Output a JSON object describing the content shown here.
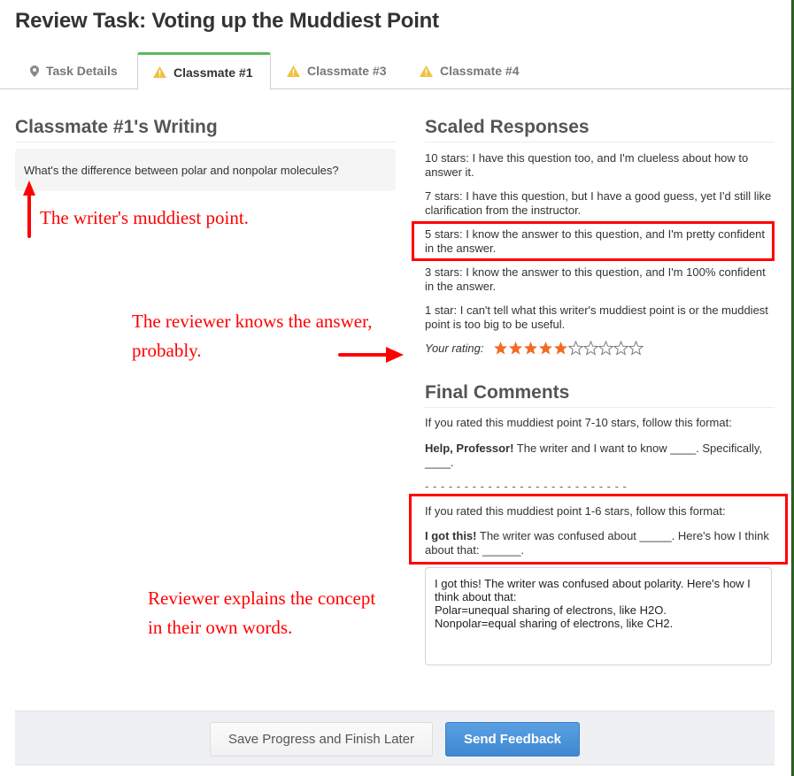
{
  "page": {
    "title": "Review Task: Voting up the Muddiest Point"
  },
  "tabs": [
    {
      "label": "Task Details",
      "icon": "map-pin-icon",
      "active": false
    },
    {
      "label": "Classmate #1",
      "icon": "warning-icon",
      "active": true
    },
    {
      "label": "Classmate #3",
      "icon": "warning-icon",
      "active": false
    },
    {
      "label": "Classmate #4",
      "icon": "warning-icon",
      "active": false
    }
  ],
  "writing": {
    "heading": "Classmate #1's Writing",
    "text": "What's the difference between polar and nonpolar molecules?"
  },
  "scaled": {
    "heading": "Scaled Responses",
    "responses": [
      "10 stars: I have this question too, and I'm clueless about how to answer it.",
      "7 stars: I have this question, but I have a good guess, yet I'd still like clarification from the instructor.",
      "5 stars: I know the answer to this question, and I'm pretty confident in the answer.",
      "3 stars: I know the answer to this question, and I'm 100% confident in the answer.",
      "1 star: I can't tell what this writer's muddiest point is or the muddiest point is too big to be useful."
    ],
    "rating_label": "Your rating:",
    "rating_value": 5,
    "rating_max": 10,
    "star_color": "#f26b22"
  },
  "final": {
    "heading": "Final Comments",
    "high_instruction": "If you rated this muddiest point 7-10 stars, follow this format:",
    "high_format_bold": "Help, Professor!",
    "high_format_rest": " The writer and I want to know ____. Specifically, ____.",
    "separator": "- - - - - - - - - - - - - - - - - - - - - - - - - -",
    "low_instruction": "If you rated this muddiest point 1-6 stars, follow this format:",
    "low_format_bold": "I got this!",
    "low_format_rest": " The writer was confused about _____. Here's how I think about that: ______.",
    "comment_value": "I got this! The writer was confused about polarity. Here's how I think about that:\nPolar=unequal sharing of electrons, like H2O.\nNonpolar=equal sharing of electrons, like CH2."
  },
  "footer": {
    "save_label": "Save Progress and Finish Later",
    "send_label": "Send Feedback"
  },
  "annotations": {
    "writer_point": "The writer's muddiest point.",
    "reviewer_knows_line1": "The reviewer knows the answer,",
    "reviewer_knows_line2": "probably.",
    "reviewer_explains_line1": "Reviewer explains the concept",
    "reviewer_explains_line2": "in their own words.",
    "color": "#ff0000"
  }
}
